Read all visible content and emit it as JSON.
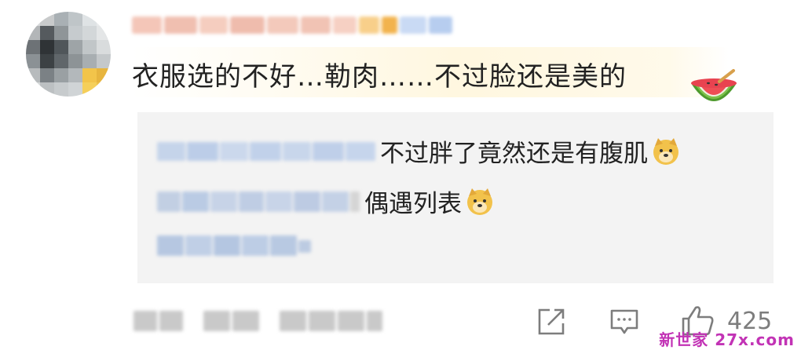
{
  "comment": {
    "text": "衣服选的不好…勒肉……不过脸还是美的",
    "emoji": "watermelon-emoji"
  },
  "replies": [
    {
      "text": "不过胖了竟然还是有腹肌",
      "emoji": "doge-emoji"
    },
    {
      "text": "偶遇列表",
      "emoji": "doge-emoji"
    }
  ],
  "actions": {
    "share_icon": "share-icon",
    "comment_icon": "comment-icon",
    "like_icon": "thumbs-up-icon",
    "like_count": "425"
  },
  "watermark": "新世家 27x.com"
}
